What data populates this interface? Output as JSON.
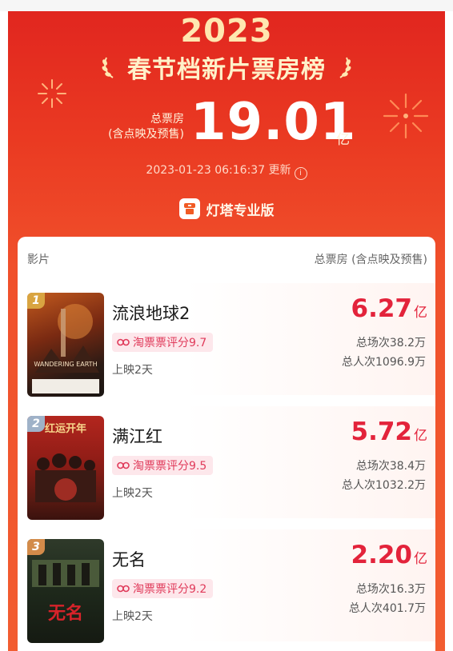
{
  "header": {
    "year": "2023",
    "title": "春节档新片票房榜",
    "total_label_line1": "总票房",
    "total_label_line2": "(含点映及预售)",
    "total_value": "19.01",
    "total_unit": "亿",
    "update_time": "2023-01-23 06:16:37 更新",
    "brand": "灯塔专业版",
    "colors": {
      "gold": "#ffe7b0",
      "red": "#e1261f"
    }
  },
  "list": {
    "col_movie": "影片",
    "col_box": "总票房 (含点映及预售)",
    "items": [
      {
        "rank": "1",
        "name": "流浪地球2",
        "rating": "淘票票评分9.7",
        "days": "上映2天",
        "box": "6.27",
        "unit": "亿",
        "shows": "总场次38.2万",
        "people": "总人次1096.9万"
      },
      {
        "rank": "2",
        "name": "满江红",
        "rating": "淘票票评分9.5",
        "days": "上映2天",
        "box": "5.72",
        "unit": "亿",
        "shows": "总场次38.4万",
        "people": "总人次1032.2万"
      },
      {
        "rank": "3",
        "name": "无名",
        "rating": "淘票票评分9.2",
        "days": "上映2天",
        "box": "2.20",
        "unit": "亿",
        "shows": "总场次16.3万",
        "people": "总人次401.7万"
      }
    ]
  },
  "posters": [
    {
      "tagline": "WANDERING EARTH",
      "icon": "rocket-poster"
    },
    {
      "tagline": "红运开年",
      "icon": "crowd-poster"
    },
    {
      "tagline": "无名",
      "icon": "green-room-poster"
    }
  ]
}
